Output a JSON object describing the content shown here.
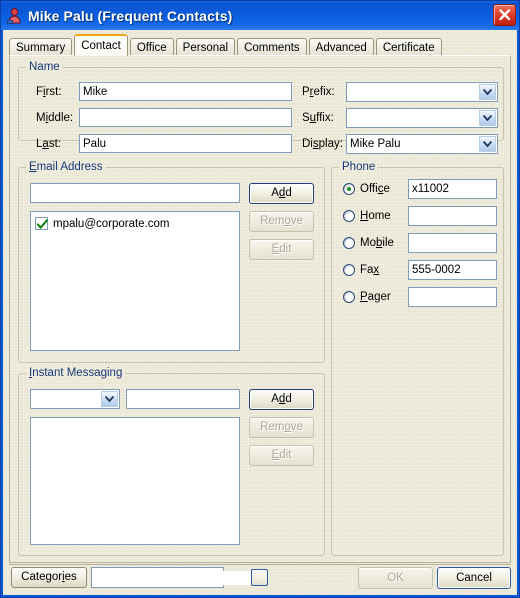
{
  "window": {
    "title": "Mike Palu (Frequent Contacts)",
    "icon": "contact-person-icon",
    "close_label": "close-icon",
    "frame_color": "#0a56d6",
    "titlebar_color": "#0a5ada",
    "client_color": "#ece9d8"
  },
  "tabs": [
    {
      "label": "Summary",
      "active": false
    },
    {
      "label": "Contact",
      "active": true
    },
    {
      "label": "Office",
      "active": false
    },
    {
      "label": "Personal",
      "active": false
    },
    {
      "label": "Comments",
      "active": false
    },
    {
      "label": "Advanced",
      "active": false
    },
    {
      "label": "Certificate",
      "active": false
    }
  ],
  "active_tab_accent": "#f3a81c",
  "name_group": {
    "legend": "Name",
    "first": {
      "label_pre": "F",
      "label_key": "i",
      "label_post": "rst:",
      "value": "Mike"
    },
    "middle": {
      "label_pre": "M",
      "label_key": "i",
      "label_post": "ddle:",
      "value": ""
    },
    "last": {
      "label_pre": "L",
      "label_key": "a",
      "label_post": "st:",
      "value": "Palu"
    },
    "prefix": {
      "label_pre": "P",
      "label_key": "r",
      "label_post": "efix:",
      "value": ""
    },
    "suffix": {
      "label_pre": "S",
      "label_key": "u",
      "label_post": "ffix:",
      "value": ""
    },
    "display": {
      "label_pre": "Di",
      "label_key": "s",
      "label_post": "play:",
      "value": "Mike Palu"
    }
  },
  "email_group": {
    "legend_pre": "",
    "legend_key": "E",
    "legend_post": "mail Address",
    "legend": "Email Address",
    "input_value": "",
    "items": [
      {
        "label": "mpalu@corporate.com",
        "checked": true
      }
    ],
    "buttons": {
      "add": {
        "pre": "A",
        "key": "d",
        "post": "d",
        "label": "Add",
        "enabled": true,
        "default": true
      },
      "remove": {
        "pre": "Rem",
        "key": "o",
        "post": "ve",
        "label": "Remove",
        "enabled": false,
        "default": false
      },
      "edit": {
        "pre": "",
        "key": "E",
        "post": "dit",
        "label": "Edit",
        "enabled": false,
        "default": false
      }
    }
  },
  "im_group": {
    "legend_pre": "",
    "legend_key": "I",
    "legend_post": "nstant Messaging",
    "legend": "Instant Messaging",
    "protocol_value": "",
    "input_value": "",
    "items": [],
    "buttons": {
      "add": {
        "pre": "A",
        "key": "d",
        "post": "d",
        "label": "Add",
        "enabled": true,
        "default": true
      },
      "remove": {
        "pre": "Rem",
        "key": "o",
        "post": "ve",
        "label": "Remove",
        "enabled": false,
        "default": false
      },
      "edit": {
        "pre": "",
        "key": "E",
        "post": "dit",
        "label": "Edit",
        "enabled": false,
        "default": false
      }
    }
  },
  "phone_group": {
    "legend": "Phone",
    "selected": "Office",
    "rows": [
      {
        "pre": "Offi",
        "key": "c",
        "post": "e",
        "label": "Office",
        "value": "x11002",
        "selected": true
      },
      {
        "pre": "",
        "key": "H",
        "post": "ome",
        "label": "Home",
        "value": "",
        "selected": false
      },
      {
        "pre": "Mo",
        "key": "b",
        "post": "ile",
        "label": "Mobile",
        "value": "",
        "selected": false
      },
      {
        "pre": "Fa",
        "key": "x",
        "post": "",
        "label": "Fax",
        "value": "555-0002",
        "selected": false
      },
      {
        "pre": "",
        "key": "P",
        "post": "ager",
        "label": "Pager",
        "value": "",
        "selected": false
      }
    ]
  },
  "bottom_bar": {
    "categories": {
      "pre": "Categor",
      "key": "i",
      "post": "es",
      "label": "Categories"
    },
    "categories_value": "",
    "categories_picker_icon": "ellipsis-picker-button",
    "ok": {
      "label": "OK",
      "enabled": false
    },
    "cancel": {
      "label": "Cancel",
      "enabled": true
    }
  }
}
